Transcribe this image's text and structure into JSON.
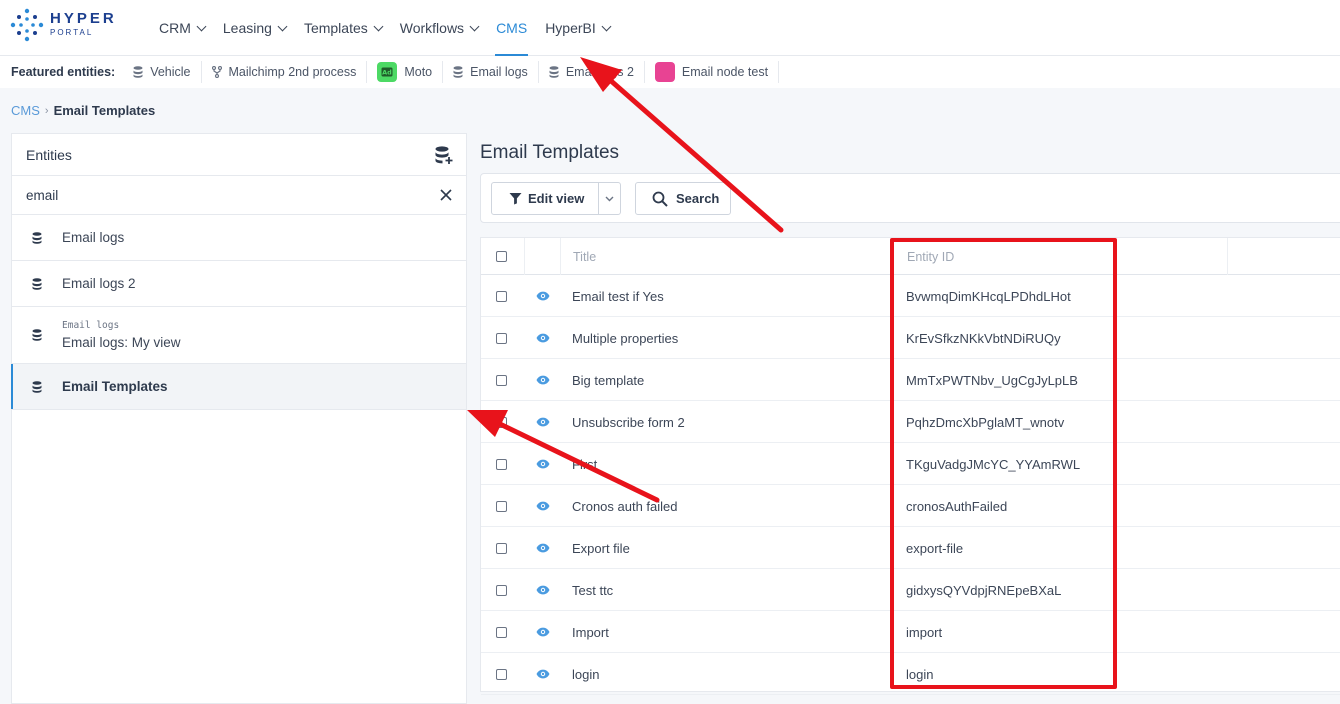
{
  "brand": {
    "name": "HYPER",
    "sub": "PORTAL"
  },
  "nav": [
    {
      "label": "CRM",
      "has_menu": true,
      "active": false
    },
    {
      "label": "Leasing",
      "has_menu": true,
      "active": false
    },
    {
      "label": "Templates",
      "has_menu": true,
      "active": false
    },
    {
      "label": "Workflows",
      "has_menu": true,
      "active": false
    },
    {
      "label": "CMS",
      "has_menu": false,
      "active": true
    },
    {
      "label": "HyperBI",
      "has_menu": true,
      "active": false
    }
  ],
  "featured": {
    "label": "Featured entities:",
    "items": [
      {
        "label": "Vehicle",
        "icon": "database-icon"
      },
      {
        "label": "Mailchimp 2nd process",
        "icon": "process-icon"
      },
      {
        "label": "Moto",
        "icon": "badge-icon",
        "color": "#4cd964"
      },
      {
        "label": "Email logs",
        "icon": "database-icon"
      },
      {
        "label": "Email logs 2",
        "icon": "database-icon"
      },
      {
        "label": "Email node test",
        "icon": "swatch",
        "color": "#e84393"
      }
    ]
  },
  "breadcrumb": {
    "root": "CMS",
    "current": "Email Templates"
  },
  "entities_panel": {
    "title": "Entities",
    "search_value": "email",
    "items": [
      {
        "label": "Email logs",
        "sub": "",
        "active": false
      },
      {
        "label": "Email logs 2",
        "sub": "",
        "active": false
      },
      {
        "label": "Email logs: My view",
        "sub": "Email logs",
        "active": false
      },
      {
        "label": "Email Templates",
        "sub": "",
        "active": true
      }
    ]
  },
  "main": {
    "title": "Email Templates",
    "edit_view_label": "Edit view",
    "search_label": "Search",
    "columns": {
      "title": "Title",
      "entity_id": "Entity ID"
    },
    "rows": [
      {
        "title": "Email test if Yes",
        "entity_id": "BvwmqDimKHcqLPDhdLHot"
      },
      {
        "title": "Multiple properties",
        "entity_id": "KrEvSfkzNKkVbtNDiRUQy"
      },
      {
        "title": "Big template",
        "entity_id": "MmTxPWTNbv_UgCgJyLpLB"
      },
      {
        "title": "Unsubscribe form 2",
        "entity_id": "PqhzDmcXbPglaMT_wnotv"
      },
      {
        "title": "First",
        "entity_id": "TKguVadgJMcYC_YYAmRWL"
      },
      {
        "title": "Cronos auth failed",
        "entity_id": "cronosAuthFailed"
      },
      {
        "title": "Export file",
        "entity_id": "export-file"
      },
      {
        "title": "Test ttc",
        "entity_id": "gidxysQYVdpjRNEpeBXaL"
      },
      {
        "title": "Import",
        "entity_id": "import"
      },
      {
        "title": "login",
        "entity_id": "login"
      }
    ]
  },
  "colors": {
    "accent": "#2b8ad6",
    "annotation": "#e8131b"
  }
}
